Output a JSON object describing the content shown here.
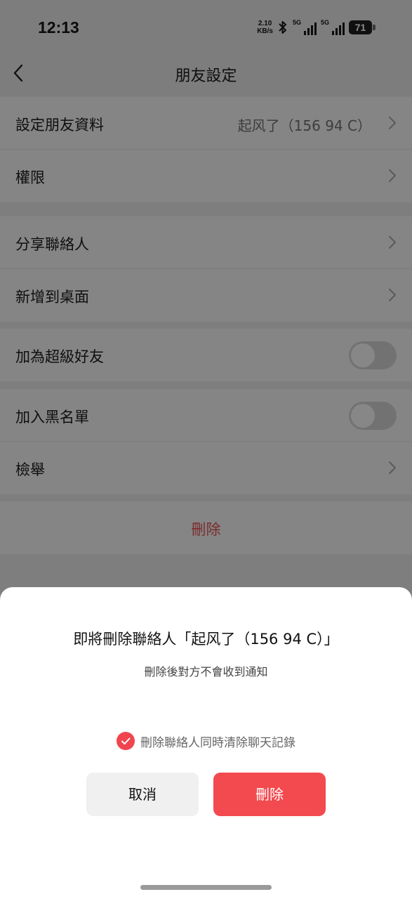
{
  "status_bar": {
    "time": "12:13",
    "net_speed_value": "2.10",
    "net_speed_unit": "KB/s",
    "bluetooth_icon": "bluetooth-icon",
    "sim1_label": "5G",
    "sim2_label": "5G",
    "battery_level": "71"
  },
  "header": {
    "back_icon": "chevron-left-icon",
    "title": "朋友設定"
  },
  "settings": {
    "friend_info": {
      "label": "設定朋友資料",
      "value": "起风了（156  94  C）"
    },
    "permissions": {
      "label": "權限"
    },
    "share_contact": {
      "label": "分享聯絡人"
    },
    "add_to_desktop": {
      "label": "新增到桌面"
    },
    "super_friend": {
      "label": "加為超級好友",
      "enabled": false
    },
    "blacklist": {
      "label": "加入黑名單",
      "enabled": false
    },
    "report": {
      "label": "檢舉"
    },
    "delete": {
      "label": "刪除"
    }
  },
  "dialog": {
    "title": "即將刪除聯絡人「起风了（156  94  C）」",
    "subtitle": "刪除後對方不會收到通知",
    "checkbox_label": "刪除聯絡人同時清除聊天記錄",
    "checkbox_checked": true,
    "cancel_label": "取消",
    "confirm_label": "刪除"
  },
  "colors": {
    "accent_red": "#f24a4f",
    "overlay_gray": "#7e7e7e"
  }
}
